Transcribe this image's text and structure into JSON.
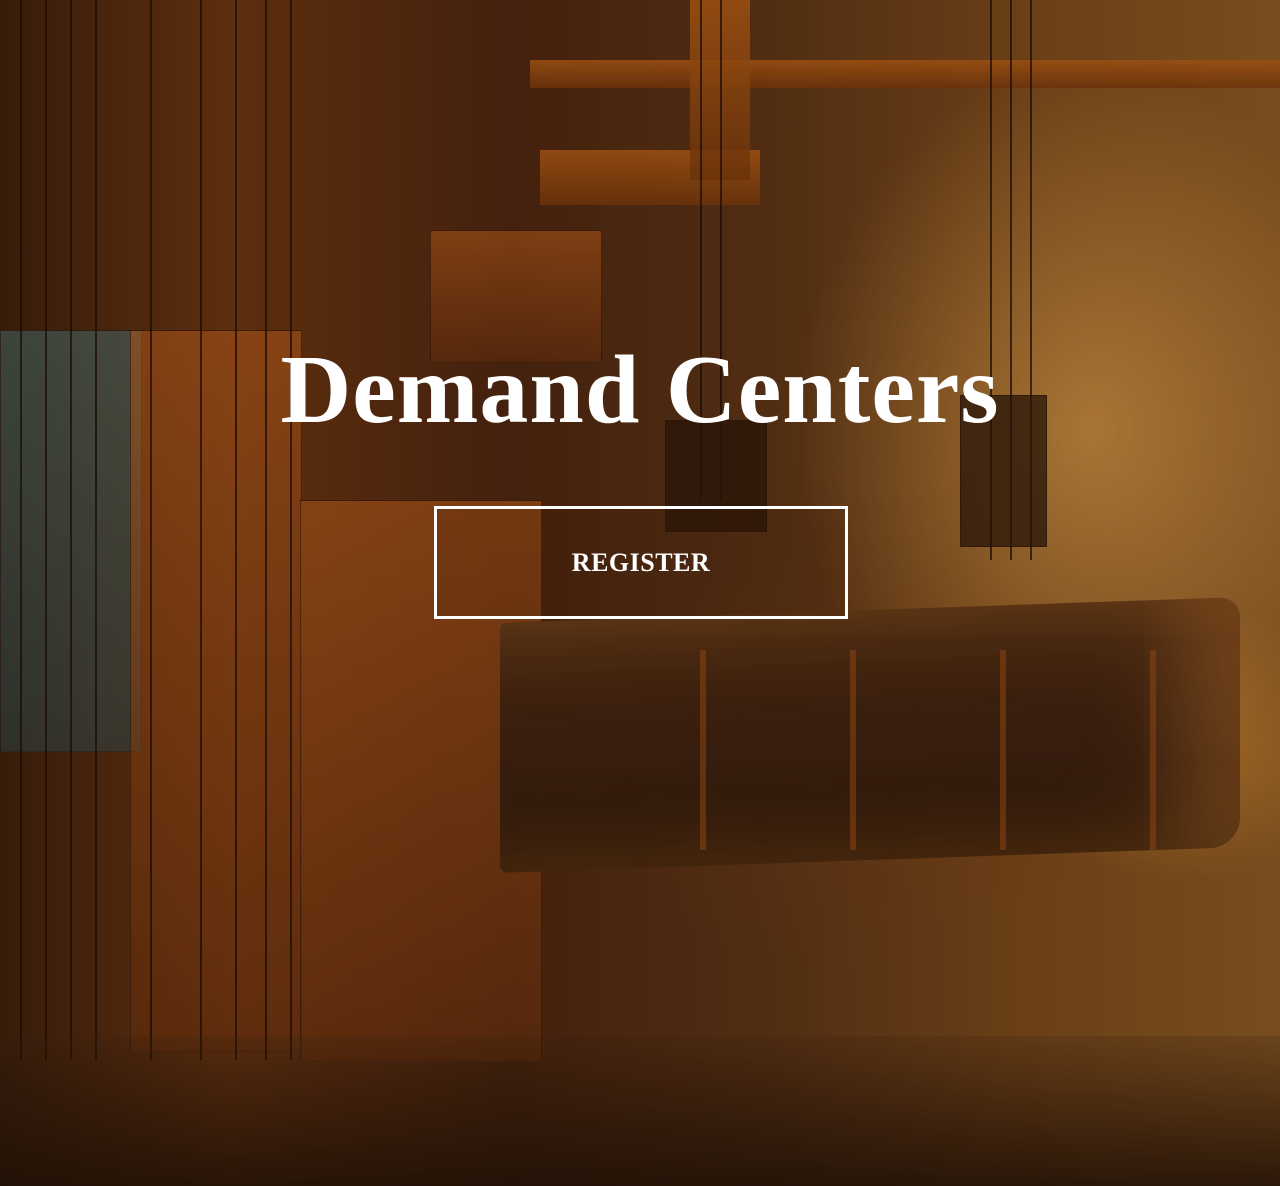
{
  "hero": {
    "title": "Demand Centers",
    "register_label": "REGISTER",
    "background_image": "industrial-steel-mill-crane-photo"
  },
  "colors": {
    "title_text": "#ffffff",
    "button_border": "#ffffff",
    "accent_orange": "#b75e14"
  }
}
